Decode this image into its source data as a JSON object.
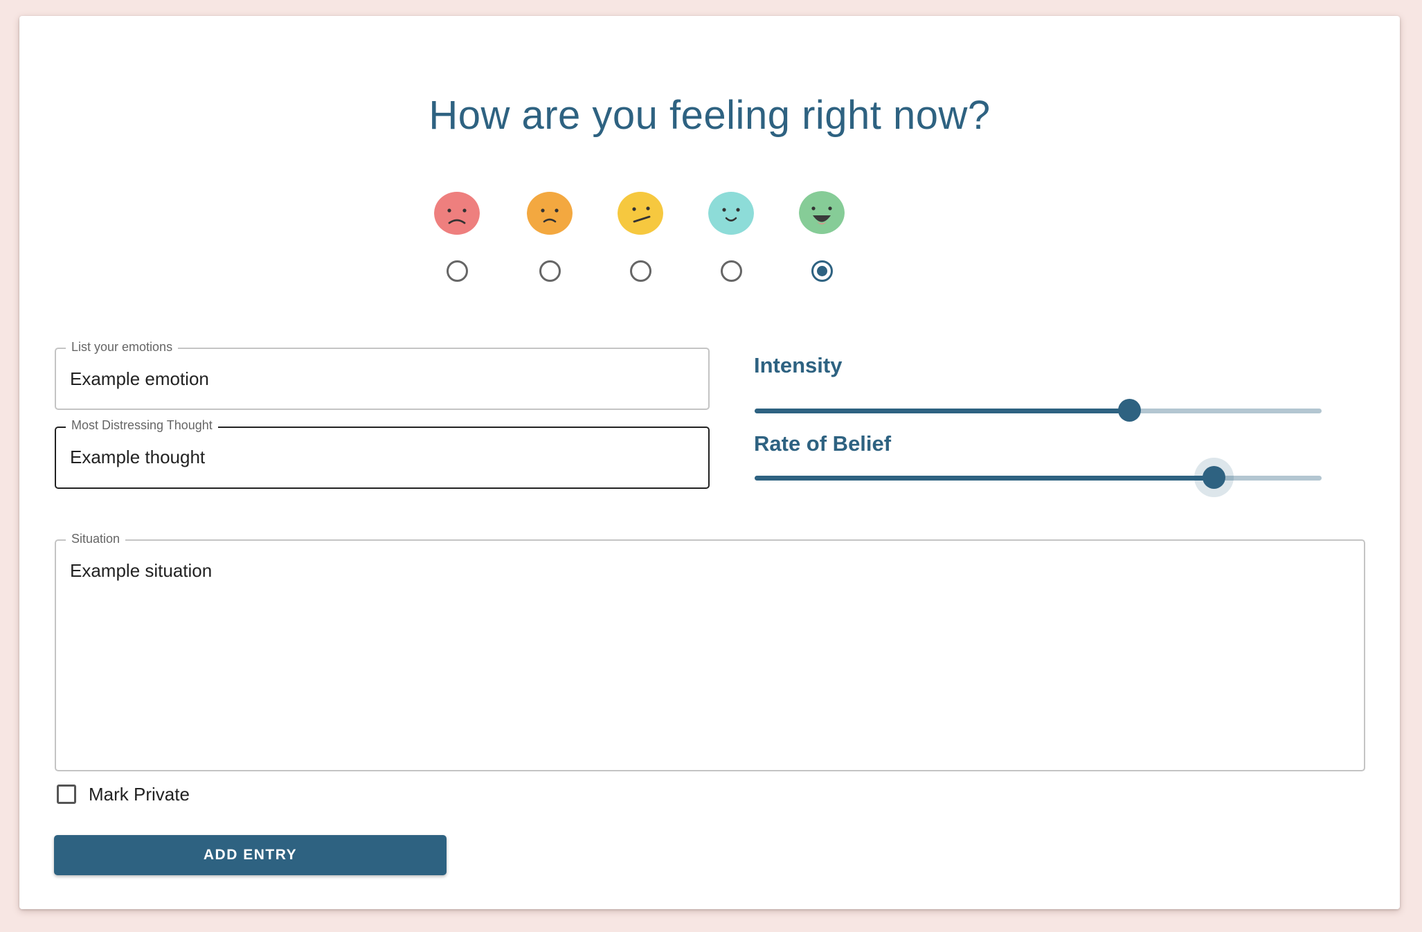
{
  "title": "How are you feeling right now?",
  "moods": [
    {
      "icon": "very-sad-face-icon",
      "color": "#ee7f7e",
      "selected": false
    },
    {
      "icon": "sad-face-icon",
      "color": "#f3a840",
      "selected": false
    },
    {
      "icon": "neutral-face-icon",
      "color": "#f6c83f",
      "selected": false
    },
    {
      "icon": "happy-face-icon",
      "color": "#8ddcd8",
      "selected": false
    },
    {
      "icon": "very-happy-face-icon",
      "color": "#86cc97",
      "selected": true
    }
  ],
  "emotions_field": {
    "label": "List your emotions",
    "value": "Example emotion"
  },
  "thought_field": {
    "label": "Most Distressing Thought",
    "value": "Example thought"
  },
  "intensity": {
    "label": "Intensity",
    "value_fraction": 0.66
  },
  "belief": {
    "label": "Rate of Belief",
    "value_fraction": 0.81
  },
  "situation_field": {
    "label": "Situation",
    "value": "Example situation"
  },
  "private_checkbox": {
    "label": "Mark Private",
    "checked": false
  },
  "submit_label": "ADD ENTRY",
  "colors": {
    "primary": "#2e6281",
    "track": "#b3c6d1",
    "background": "#f7e6e3"
  }
}
